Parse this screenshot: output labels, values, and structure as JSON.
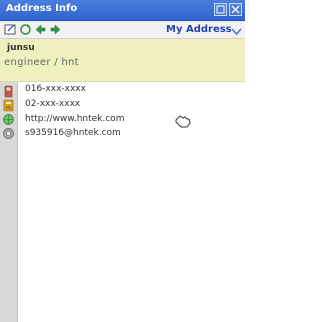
{
  "window": {
    "title": "Address Info"
  },
  "toolbar": {
    "dropdown_label": "My Address"
  },
  "contact": {
    "name": "junsu",
    "job": "engineer / hnt"
  },
  "details": [
    {
      "icon": "phone-icon",
      "text": "016-xxx-xxxx"
    },
    {
      "icon": "phone-icon",
      "text": "02-xxx-xxxx"
    },
    {
      "icon": "globe-icon",
      "text": "http://www.hntek.com"
    },
    {
      "icon": "email-icon",
      "text": "s935916@hntek.com"
    }
  ],
  "colors": {
    "title_bar": "#3a6ed6",
    "header_bg": "#efefbf",
    "icon_column": "#d8d8d8"
  }
}
